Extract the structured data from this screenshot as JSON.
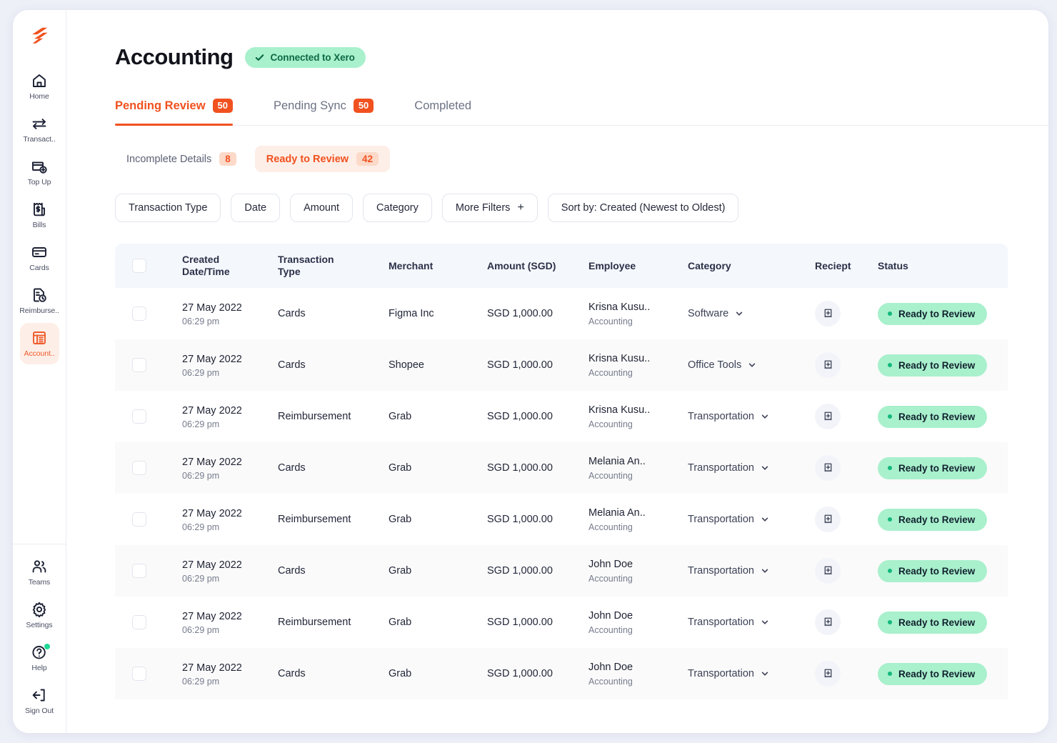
{
  "sidebar": {
    "logo": "spenmo-logo",
    "items": [
      {
        "label": "Home",
        "icon": "home-icon",
        "active": false
      },
      {
        "label": "Transact..",
        "icon": "transfer-icon",
        "active": false
      },
      {
        "label": "Top Up",
        "icon": "top-up-icon",
        "active": false
      },
      {
        "label": "Bills",
        "icon": "bills-icon",
        "active": false
      },
      {
        "label": "Cards",
        "icon": "card-icon",
        "active": false
      },
      {
        "label": "Reimburse..",
        "icon": "reimbursement-icon",
        "active": false
      },
      {
        "label": "Account..",
        "icon": "accounting-icon",
        "active": true
      }
    ],
    "bottom_items": [
      {
        "label": "Teams",
        "icon": "teams-icon",
        "dot": false
      },
      {
        "label": "Settings",
        "icon": "gear-icon",
        "dot": false
      },
      {
        "label": "Help",
        "icon": "help-icon",
        "dot": true
      },
      {
        "label": "Sign Out",
        "icon": "sign-out-icon",
        "dot": false
      }
    ]
  },
  "header": {
    "title": "Accounting",
    "connection_badge": "Connected to Xero"
  },
  "tabs": [
    {
      "label": "Pending Review",
      "badge": "50",
      "active": true
    },
    {
      "label": "Pending Sync",
      "badge": "50",
      "active": false
    },
    {
      "label": "Completed",
      "badge": "",
      "active": false
    }
  ],
  "subtabs": [
    {
      "label": "Incomplete Details",
      "badge": "8",
      "active": false
    },
    {
      "label": "Ready to Review",
      "badge": "42",
      "active": true
    }
  ],
  "filters": [
    {
      "label": "Transaction Type",
      "plus": false
    },
    {
      "label": "Date",
      "plus": false
    },
    {
      "label": "Amount",
      "plus": false
    },
    {
      "label": "Category",
      "plus": false
    },
    {
      "label": "More Filters",
      "plus": true
    },
    {
      "label": "Sort by: Created (Newest to Oldest)",
      "plus": false
    }
  ],
  "table": {
    "columns": {
      "created": "Created\nDate/Time",
      "created_l1": "Created",
      "created_l2": "Date/Time",
      "type_l1": "Transaction",
      "type_l2": "Type",
      "merchant": "Merchant",
      "amount": "Amount (SGD)",
      "employee": "Employee",
      "category": "Category",
      "receipt": "Reciept",
      "status": "Status"
    },
    "rows": [
      {
        "date": "27 May 2022",
        "time": "06:29 pm",
        "type": "Cards",
        "merchant": "Figma Inc",
        "amount": "SGD 1,000.00",
        "employee": "Krisna Kusu..",
        "department": "Accounting",
        "category": "Software",
        "receipt_icon": "receipt-add-icon",
        "status": "Ready to Review"
      },
      {
        "date": "27 May 2022",
        "time": "06:29 pm",
        "type": "Cards",
        "merchant": "Shopee",
        "amount": "SGD 1,000.00",
        "employee": "Krisna Kusu..",
        "department": "Accounting",
        "category": "Office Tools",
        "receipt_icon": "receipt-add-icon",
        "status": "Ready to Review"
      },
      {
        "date": "27 May 2022",
        "time": "06:29 pm",
        "type": "Reimbursement",
        "merchant": "Grab",
        "amount": "SGD 1,000.00",
        "employee": "Krisna Kusu..",
        "department": "Accounting",
        "category": "Transportation",
        "receipt_icon": "receipt-add-icon",
        "status": "Ready to Review"
      },
      {
        "date": "27 May 2022",
        "time": "06:29 pm",
        "type": "Cards",
        "merchant": "Grab",
        "amount": "SGD 1,000.00",
        "employee": "Melania An..",
        "department": "Accounting",
        "category": "Transportation",
        "receipt_icon": "receipt-add-icon",
        "status": "Ready to Review"
      },
      {
        "date": "27 May 2022",
        "time": "06:29 pm",
        "type": "Reimbursement",
        "merchant": "Grab",
        "amount": "SGD 1,000.00",
        "employee": "Melania An..",
        "department": "Accounting",
        "category": "Transportation",
        "receipt_icon": "receipt-add-icon",
        "status": "Ready to Review"
      },
      {
        "date": "27 May 2022",
        "time": "06:29 pm",
        "type": "Cards",
        "merchant": "Grab",
        "amount": "SGD 1,000.00",
        "employee": "John Doe",
        "department": "Accounting",
        "category": "Transportation",
        "receipt_icon": "receipt-add-icon",
        "status": "Ready to Review"
      },
      {
        "date": "27 May 2022",
        "time": "06:29 pm",
        "type": "Reimbursement",
        "merchant": "Grab",
        "amount": "SGD 1,000.00",
        "employee": "John Doe",
        "department": "Accounting",
        "category": "Transportation",
        "receipt_icon": "receipt-add-icon",
        "status": "Ready to Review"
      },
      {
        "date": "27 May 2022",
        "time": "06:29 pm",
        "type": "Cards",
        "merchant": "Grab",
        "amount": "SGD 1,000.00",
        "employee": "John Doe",
        "department": "Accounting",
        "category": "Transportation",
        "receipt_icon": "receipt-add-icon",
        "status": "Ready to Review"
      }
    ]
  },
  "colors": {
    "brand_orange": "#f0511f",
    "brand_orange_soft": "#fdeee7",
    "badge_orange_soft": "#fcd9c8",
    "success_green": "#a9f0cd",
    "success_green_text": "#0d6a44",
    "status_dot_green": "#13b87c",
    "header_row_bg": "#f4f7fc",
    "alt_row_bg": "#fafafa",
    "page_bg": "#eef0f8"
  }
}
